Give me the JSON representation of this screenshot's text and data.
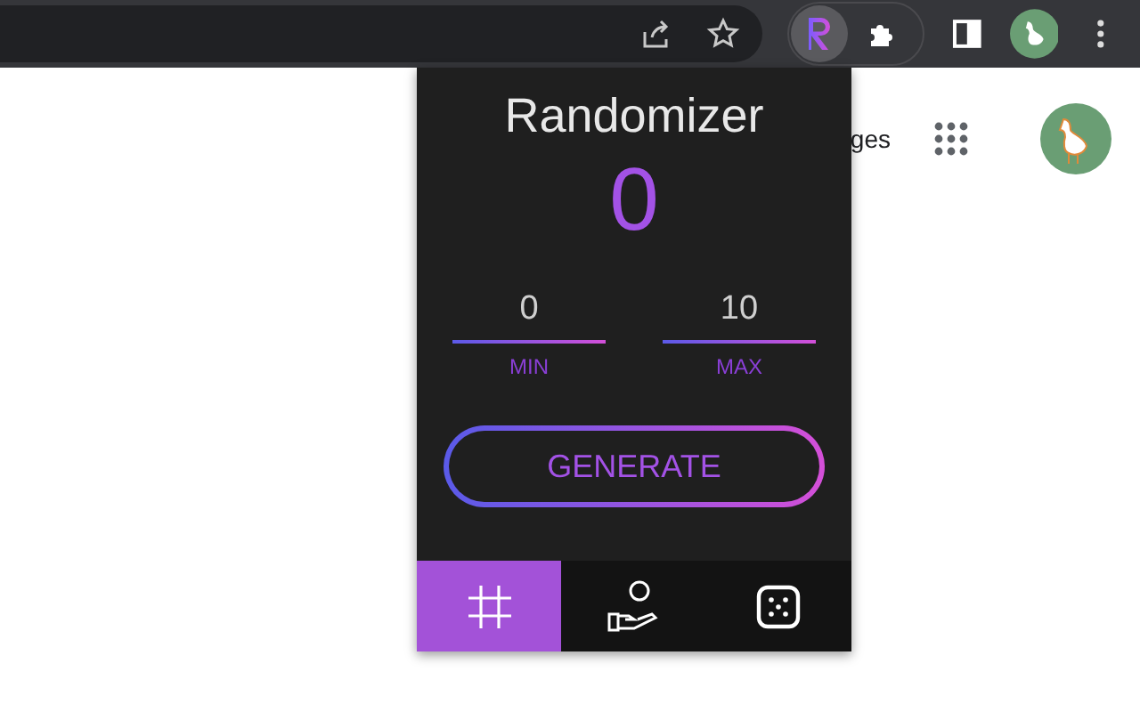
{
  "page": {
    "link_fragment": "ges"
  },
  "popup": {
    "title": "Randomizer",
    "result": "0",
    "min": {
      "value": "0",
      "label": "MIN"
    },
    "max": {
      "value": "10",
      "label": "MAX"
    },
    "button": "GENERATE",
    "tabs": [
      {
        "kind": "number",
        "selected": true
      },
      {
        "kind": "coin",
        "selected": false
      },
      {
        "kind": "dice",
        "selected": false
      }
    ]
  }
}
